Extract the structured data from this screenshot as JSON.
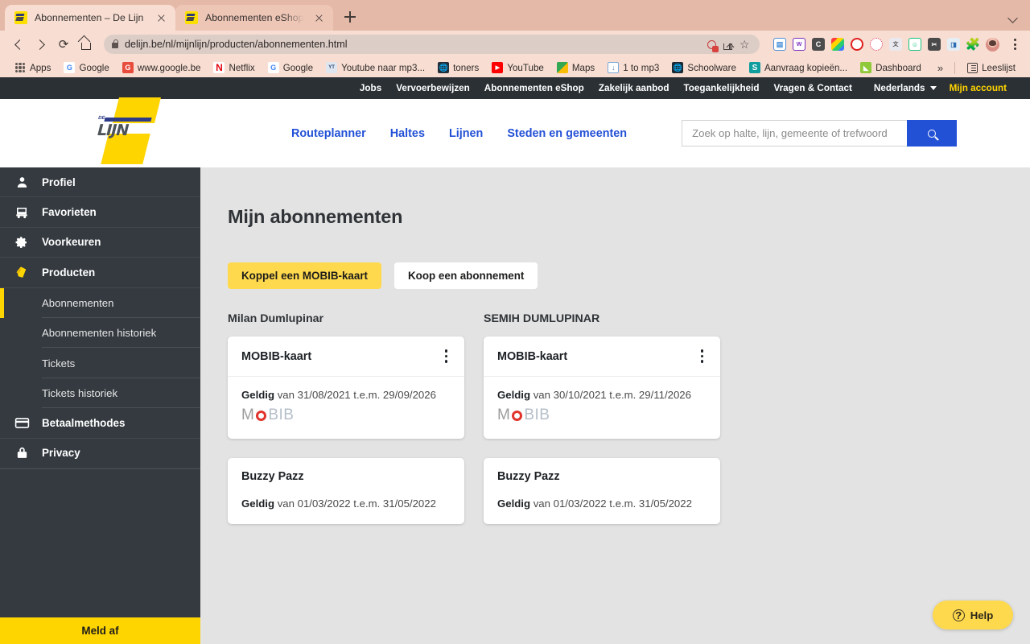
{
  "browser": {
    "tabs": [
      {
        "title": "Abonnementen – De Lijn",
        "active": true
      },
      {
        "title": "Abonnementen eShop - De Lijn",
        "active": false
      }
    ],
    "url": "delijn.be/nl/mijnlijn/producten/abonnementen.html",
    "bookmarks": [
      {
        "label": "Apps",
        "icon": "apps-grid-icon"
      },
      {
        "label": "Google",
        "icon": "google-icon"
      },
      {
        "label": "www.google.be",
        "icon": "google-red-icon"
      },
      {
        "label": "Netflix",
        "icon": "netflix-icon"
      },
      {
        "label": "Google",
        "icon": "google-icon"
      },
      {
        "label": "Youtube naar mp3...",
        "icon": "yt-mp3-icon"
      },
      {
        "label": "toners",
        "icon": "globe-icon"
      },
      {
        "label": "YouTube",
        "icon": "youtube-icon"
      },
      {
        "label": "Maps",
        "icon": "maps-icon"
      },
      {
        "label": "1 to mp3",
        "icon": "download-icon"
      },
      {
        "label": "Schoolware",
        "icon": "globe-dark-icon"
      },
      {
        "label": "Aanvraag kopieën...",
        "icon": "s-icon"
      },
      {
        "label": "Dashboard",
        "icon": "leaf-icon"
      }
    ],
    "bookmark_overflow": "»",
    "reading_list": "Leeslijst"
  },
  "utilbar": {
    "links": [
      "Jobs",
      "Vervoerbewijzen",
      "Abonnementen eShop",
      "Zakelijk aanbod",
      "Toegankelijkheid",
      "Vragen & Contact"
    ],
    "language": "Nederlands",
    "account": "Mijn account"
  },
  "header": {
    "logo_de": "DE",
    "logo_lijn": "LIJN",
    "nav": [
      "Routeplanner",
      "Haltes",
      "Lijnen",
      "Steden en gemeenten"
    ],
    "search_placeholder": "Zoek op halte, lijn, gemeente of trefwoord",
    "search_value": ""
  },
  "sidebar": {
    "items": [
      {
        "label": "Profiel",
        "icon": "person-icon",
        "type": "main"
      },
      {
        "label": "Favorieten",
        "icon": "bus-icon",
        "type": "main"
      },
      {
        "label": "Voorkeuren",
        "icon": "gear-icon",
        "type": "main"
      },
      {
        "label": "Producten",
        "icon": "tag-icon",
        "type": "main"
      },
      {
        "label": "Abonnementen",
        "icon": "",
        "type": "sub",
        "active": true
      },
      {
        "label": "Abonnementen historiek",
        "icon": "",
        "type": "sub"
      },
      {
        "label": "Tickets",
        "icon": "",
        "type": "sub"
      },
      {
        "label": "Tickets historiek",
        "icon": "",
        "type": "sub"
      },
      {
        "label": "Betaalmethodes",
        "icon": "card-icon",
        "type": "main"
      },
      {
        "label": "Privacy",
        "icon": "lock-icon",
        "type": "main"
      }
    ],
    "logout": "Meld af"
  },
  "main": {
    "title": "Mijn abonnementen",
    "primary_button": "Koppel een MOBIB-kaart",
    "secondary_button": "Koop een abonnement",
    "columns": [
      {
        "owner": "Milan Dumlupinar",
        "cards": [
          {
            "title": "MOBIB-kaart",
            "valid_label": "Geldig",
            "valid_text": " van 31/08/2021 t.e.m. 29/09/2026",
            "has_mobib_logo": true,
            "mobib_m": "M",
            "mobib_bib": "BIB"
          },
          {
            "title": "Buzzy Pazz",
            "valid_label": "Geldig",
            "valid_text": " van 01/03/2022 t.e.m. 31/05/2022",
            "has_mobib_logo": false
          }
        ]
      },
      {
        "owner": "SEMIH DUMLUPINAR",
        "cards": [
          {
            "title": "MOBIB-kaart",
            "valid_label": "Geldig",
            "valid_text": " van 30/10/2021 t.e.m. 29/11/2026",
            "has_mobib_logo": true,
            "mobib_m": "M",
            "mobib_bib": "BIB"
          },
          {
            "title": "Buzzy Pazz",
            "valid_label": "Geldig",
            "valid_text": " van 01/03/2022 t.e.m. 31/05/2022",
            "has_mobib_logo": false
          }
        ]
      }
    ]
  },
  "help": {
    "label": "Help",
    "icon_char": "?"
  },
  "colors": {
    "brand_yellow": "#ffd500",
    "brand_blue": "#2351d6",
    "sidebar_dark": "#343a40",
    "utilbar_dark": "#2b3035",
    "page_bg": "#e3e3e3",
    "mobib_red": "#e0342c",
    "chrome_pink": "#f7ddd2"
  }
}
